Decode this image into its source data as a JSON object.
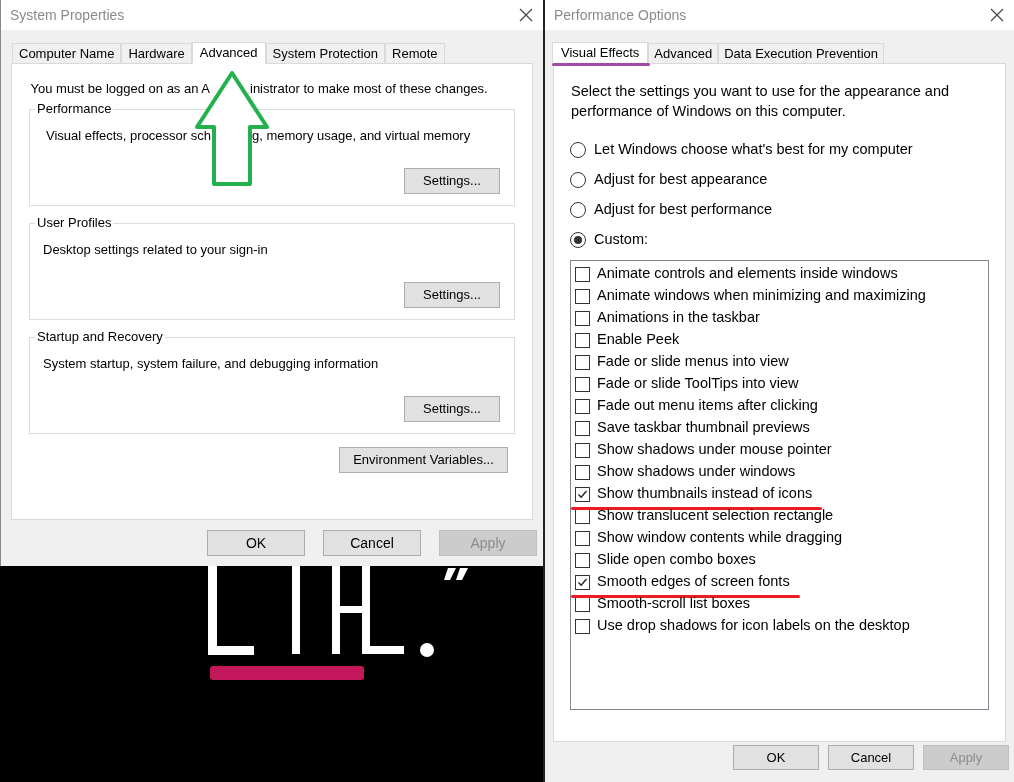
{
  "system_properties": {
    "title": "System Properties",
    "tabs": [
      {
        "label": "Computer Name",
        "selected": false,
        "arrow": false
      },
      {
        "label": "Hardware",
        "selected": false,
        "arrow": false
      },
      {
        "label": "Advanced",
        "selected": true,
        "arrow": true
      },
      {
        "label": "System Protection",
        "selected": false,
        "arrow": false
      },
      {
        "label": "Remote",
        "selected": false,
        "arrow": false
      }
    ],
    "notice": [
      "You must be logged on as an A",
      "inistrator to make most of these changes."
    ],
    "groups": [
      {
        "title": "Performance",
        "description": [
          "Visual effects, processor sch",
          "g, memory usage, and virtual memory"
        ],
        "button": "Settings..."
      },
      {
        "title": "User Profiles",
        "description": [
          "Desktop settings related to your sign-in"
        ],
        "button": "Settings..."
      },
      {
        "title": "Startup and Recovery",
        "description": [
          "System startup, system failure, and debugging information"
        ],
        "button": "Settings..."
      }
    ],
    "environment_button": "Environment Variables...",
    "buttons": [
      {
        "label": "OK",
        "disabled": false
      },
      {
        "label": "Cancel",
        "disabled": false
      },
      {
        "label": "Apply",
        "disabled": true
      }
    ]
  },
  "performance_options": {
    "title": "Performance Options",
    "tabs": [
      {
        "label": "Visual Effects",
        "selected": true,
        "underlined": true
      },
      {
        "label": "Advanced",
        "selected": false,
        "underlined": false
      },
      {
        "label": "Data Execution Prevention",
        "selected": false,
        "underlined": false
      }
    ],
    "intro": "Select the settings you want to use for the appearance and performance of Windows on this computer.",
    "radios": [
      {
        "label": "Let Windows choose what's best for my computer",
        "selected": false
      },
      {
        "label": "Adjust for best appearance",
        "selected": false
      },
      {
        "label": "Adjust for best performance",
        "selected": false
      },
      {
        "label": "Custom:",
        "selected": true
      }
    ],
    "effects": [
      {
        "label": "Animate controls and elements inside windows",
        "checked": false,
        "underlined": false
      },
      {
        "label": "Animate windows when minimizing and maximizing",
        "checked": false,
        "underlined": false
      },
      {
        "label": "Animations in the taskbar",
        "checked": false,
        "underlined": false
      },
      {
        "label": "Enable Peek",
        "checked": false,
        "underlined": false
      },
      {
        "label": "Fade or slide menus into view",
        "checked": false,
        "underlined": false
      },
      {
        "label": "Fade or slide ToolTips into view",
        "checked": false,
        "underlined": false
      },
      {
        "label": "Fade out menu items after clicking",
        "checked": false,
        "underlined": false
      },
      {
        "label": "Save taskbar thumbnail previews",
        "checked": false,
        "underlined": false
      },
      {
        "label": "Show shadows under mouse pointer",
        "checked": false,
        "underlined": false
      },
      {
        "label": "Show shadows under windows",
        "checked": false,
        "underlined": false
      },
      {
        "label": "Show thumbnails instead of icons",
        "checked": true,
        "underlined": true
      },
      {
        "label": "Show translucent selection rectangle",
        "checked": false,
        "underlined": false
      },
      {
        "label": "Show window contents while dragging",
        "checked": false,
        "underlined": false
      },
      {
        "label": "Slide open combo boxes",
        "checked": false,
        "underlined": false
      },
      {
        "label": "Smooth edges of screen fonts",
        "checked": true,
        "underlined": true
      },
      {
        "label": "Smooth-scroll list boxes",
        "checked": false,
        "underlined": false
      },
      {
        "label": "Use drop shadows for icon labels on the desktop",
        "checked": false,
        "underlined": false
      }
    ],
    "buttons": [
      {
        "label": "OK",
        "disabled": false
      },
      {
        "label": "Cancel",
        "disabled": false
      },
      {
        "label": "Apply",
        "disabled": true
      }
    ]
  }
}
